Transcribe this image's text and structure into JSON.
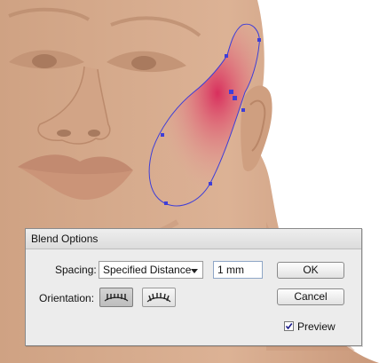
{
  "dialog": {
    "title": "Blend Options",
    "spacing_label": "Spacing:",
    "spacing_value": "Specified Distance",
    "distance_value": "1 mm",
    "orientation_label": "Orientation:",
    "ok_label": "OK",
    "cancel_label": "Cancel",
    "preview_label": "Preview",
    "preview_checked": true
  },
  "icons": {
    "orientation_align_page": "align-to-page-icon",
    "orientation_align_path": "align-to-path-icon",
    "spacing_dropdown": "chevron-down-icon",
    "preview_checkbox": "checkmark-icon"
  },
  "colors": {
    "skin": "#d7ab8d",
    "blush": "#d8285a",
    "path_stroke": "#3e3ed8",
    "dialog_bg": "#ececec"
  }
}
